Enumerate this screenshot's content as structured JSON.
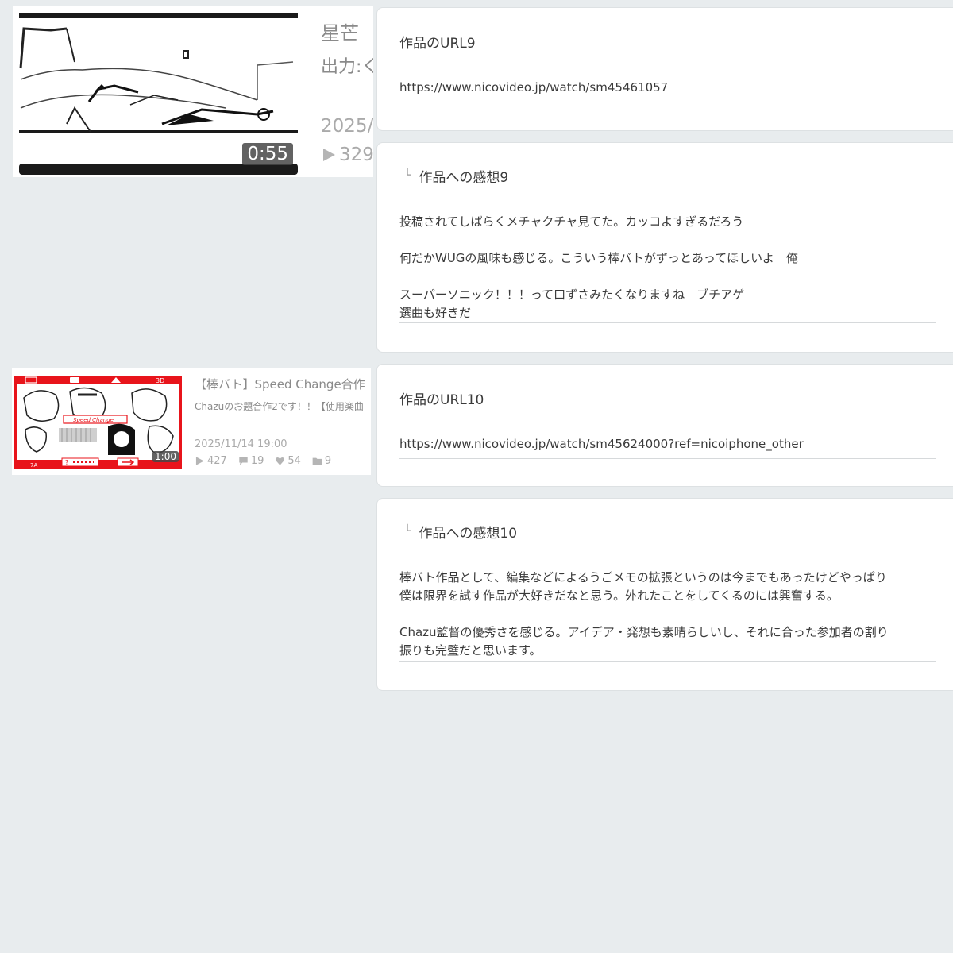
{
  "videos": [
    {
      "title": "星芒",
      "description": "出力:く",
      "duration": "0:55",
      "date": "2025/",
      "views": "329"
    },
    {
      "title": "【棒バト】Speed Change合作",
      "description": "Chazuのお題合作2です！！【使用楽曲",
      "duration": "1:00",
      "date": "2025/11/14 19:00",
      "views": "427",
      "comments": "19",
      "likes": "54",
      "mylists": "9",
      "thumb_text": {
        "banner": "Speed Change",
        "tag_3d": "3D",
        "tag_7a": "7A",
        "tag_q": "?"
      }
    }
  ],
  "form": [
    {
      "label": "作品のURL9",
      "value": "https://www.nicovideo.jp/watch/sm45461057"
    },
    {
      "indent_mark": "└",
      "label": "作品への感想9",
      "lines": [
        "投稿されてしばらくメチャクチャ見てた。カッコよすぎるだろう",
        "",
        "何だかWUGの風味も感じる。こういう棒バトがずっとあってほしいよ　俺",
        "",
        "スーパーソニック！！！って口ずさみたくなりますね　ブチアゲ",
        "選曲も好きだ"
      ]
    },
    {
      "label": "作品のURL10",
      "value": "https://www.nicovideo.jp/watch/sm45624000?ref=nicoiphone_other"
    },
    {
      "indent_mark": "└",
      "label": "作品への感想10",
      "lines": [
        "棒バト作品として、編集などによるうごメモの拡張というのは今までもあったけどやっぱり",
        "僕は限界を試す作品が大好きだなと思う。外れたことをしてくるのには興奮する。",
        "",
        "Chazu監督の優秀さを感じる。アイデア・発想も素晴らしいし、それに合った参加者の割り",
        "振りも完璧だと思います。"
      ]
    }
  ],
  "colors": {
    "page_bg": "#e8ecee",
    "thumb_red": "#e8141b",
    "text_main": "#3a3a3a",
    "text_muted": "#aaaaaa"
  }
}
